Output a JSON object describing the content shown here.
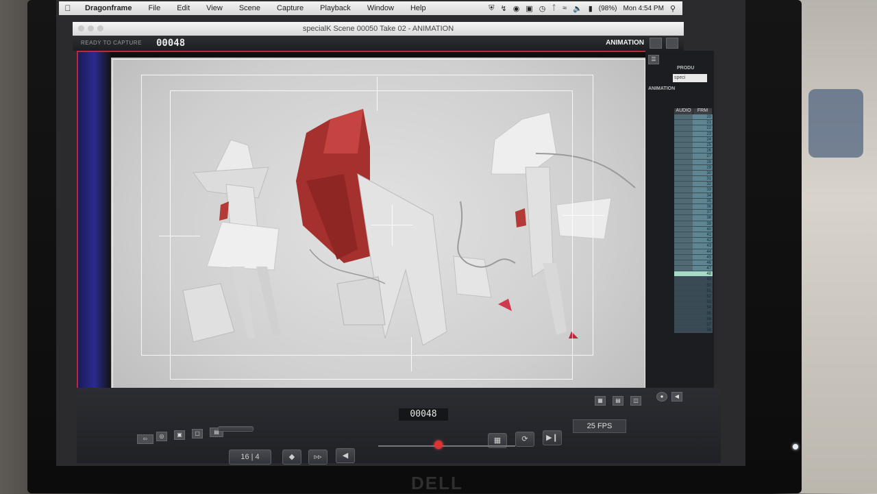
{
  "menubar": {
    "app": "Dragonframe",
    "items": [
      "File",
      "Edit",
      "View",
      "Scene",
      "Capture",
      "Playback",
      "Window",
      "Help"
    ],
    "battery": "(98%)",
    "clock": "Mon 4:54 PM"
  },
  "window": {
    "title": "specialK  Scene 00050  Take 02 - ANIMATION"
  },
  "status": {
    "ready": "READY TO CAPTURE",
    "frame": "00048",
    "mode": "ANIMATION"
  },
  "panel": {
    "production_label": "PRODU",
    "production_value": "speci",
    "section_label": "ANIMATION",
    "xsheet_headers": [
      "AUDIO",
      "FRM"
    ],
    "frames": [
      20,
      21,
      22,
      23,
      24,
      25,
      26,
      27,
      28,
      29,
      30,
      31,
      32,
      33,
      34,
      35,
      36,
      37,
      38,
      39,
      40,
      41,
      42,
      43,
      44,
      45,
      46,
      47,
      48,
      49,
      50,
      51,
      52,
      53,
      54,
      55,
      56,
      57,
      58
    ],
    "current_frame": 48
  },
  "controls": {
    "frame_display": "00048",
    "fps": "25 FPS",
    "step": "16 | 4"
  },
  "monitor": {
    "brand": "DELL"
  },
  "colors": {
    "accent_red": "#c0273a",
    "current_frame": "#a7d8c8"
  }
}
